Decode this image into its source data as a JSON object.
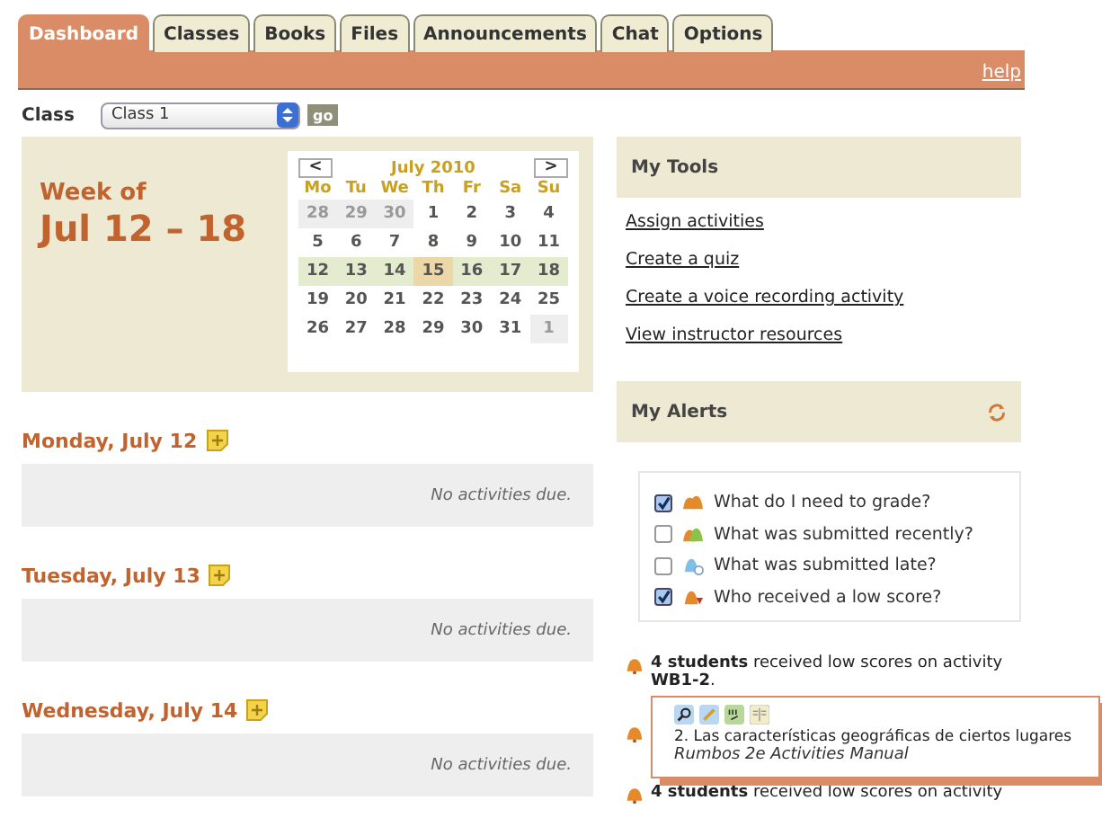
{
  "tabs": [
    {
      "label": "Dashboard",
      "selected": true
    },
    {
      "label": "Classes",
      "selected": false
    },
    {
      "label": "Books",
      "selected": false
    },
    {
      "label": "Files",
      "selected": false
    },
    {
      "label": "Announcements",
      "selected": false
    },
    {
      "label": "Chat",
      "selected": false
    },
    {
      "label": "Options",
      "selected": false
    }
  ],
  "help_link": "help",
  "class_picker": {
    "label": "Class",
    "value": "Class 1",
    "button": "go"
  },
  "week": {
    "caption": "Week of",
    "range": "Jul 12 – 18"
  },
  "calendar": {
    "prev": "<",
    "next": ">",
    "month": "July 2010",
    "weekdays": [
      "Mo",
      "Tu",
      "We",
      "Th",
      "Fr",
      "Sa",
      "Su"
    ],
    "weeks": [
      [
        {
          "day": "28",
          "kind": "other"
        },
        {
          "day": "29",
          "kind": "other"
        },
        {
          "day": "30",
          "kind": "other"
        },
        {
          "day": "1",
          "kind": "normal"
        },
        {
          "day": "2",
          "kind": "normal"
        },
        {
          "day": "3",
          "kind": "normal"
        },
        {
          "day": "4",
          "kind": "normal"
        }
      ],
      [
        {
          "day": "5",
          "kind": "normal"
        },
        {
          "day": "6",
          "kind": "normal"
        },
        {
          "day": "7",
          "kind": "normal"
        },
        {
          "day": "8",
          "kind": "normal"
        },
        {
          "day": "9",
          "kind": "normal"
        },
        {
          "day": "10",
          "kind": "normal"
        },
        {
          "day": "11",
          "kind": "normal"
        }
      ],
      [
        {
          "day": "12",
          "kind": "week"
        },
        {
          "day": "13",
          "kind": "week"
        },
        {
          "day": "14",
          "kind": "week"
        },
        {
          "day": "15",
          "kind": "today"
        },
        {
          "day": "16",
          "kind": "week"
        },
        {
          "day": "17",
          "kind": "week"
        },
        {
          "day": "18",
          "kind": "week"
        }
      ],
      [
        {
          "day": "19",
          "kind": "normal"
        },
        {
          "day": "20",
          "kind": "normal"
        },
        {
          "day": "21",
          "kind": "normal"
        },
        {
          "day": "22",
          "kind": "normal"
        },
        {
          "day": "23",
          "kind": "normal"
        },
        {
          "day": "24",
          "kind": "normal"
        },
        {
          "day": "25",
          "kind": "normal"
        }
      ],
      [
        {
          "day": "26",
          "kind": "normal"
        },
        {
          "day": "27",
          "kind": "normal"
        },
        {
          "day": "28",
          "kind": "normal"
        },
        {
          "day": "29",
          "kind": "normal"
        },
        {
          "day": "30",
          "kind": "normal"
        },
        {
          "day": "31",
          "kind": "normal"
        },
        {
          "day": "1",
          "kind": "other"
        }
      ]
    ]
  },
  "days": [
    {
      "title": "Monday, July 12",
      "empty": "No activities due."
    },
    {
      "title": "Tuesday, July 13",
      "empty": "No activities due."
    },
    {
      "title": "Wednesday, July 14",
      "empty": "No activities due."
    }
  ],
  "my_tools": {
    "title": "My Tools",
    "links": [
      "Assign activities",
      "Create a quiz",
      "Create a voice recording activity",
      "View instructor resources"
    ]
  },
  "my_alerts": {
    "title": "My Alerts",
    "filters": [
      {
        "label": "What do I need to grade?",
        "checked": true,
        "kind": "grade"
      },
      {
        "label": "What was submitted recently?",
        "checked": false,
        "kind": "recent"
      },
      {
        "label": "What was submitted late?",
        "checked": false,
        "kind": "late"
      },
      {
        "label": "Who received a low score?",
        "checked": true,
        "kind": "low"
      }
    ],
    "alerts": [
      {
        "kind": "message",
        "text": "**4 students** received low scores on activity **WB1-2**."
      },
      {
        "kind": "covered"
      },
      {
        "kind": "message",
        "text": "**4 students** received low scores on activity"
      }
    ]
  },
  "popover": {
    "title": "2. Las características geográficas de ciertos lugares",
    "source": "Rumbos 2e Activities Manual"
  }
}
